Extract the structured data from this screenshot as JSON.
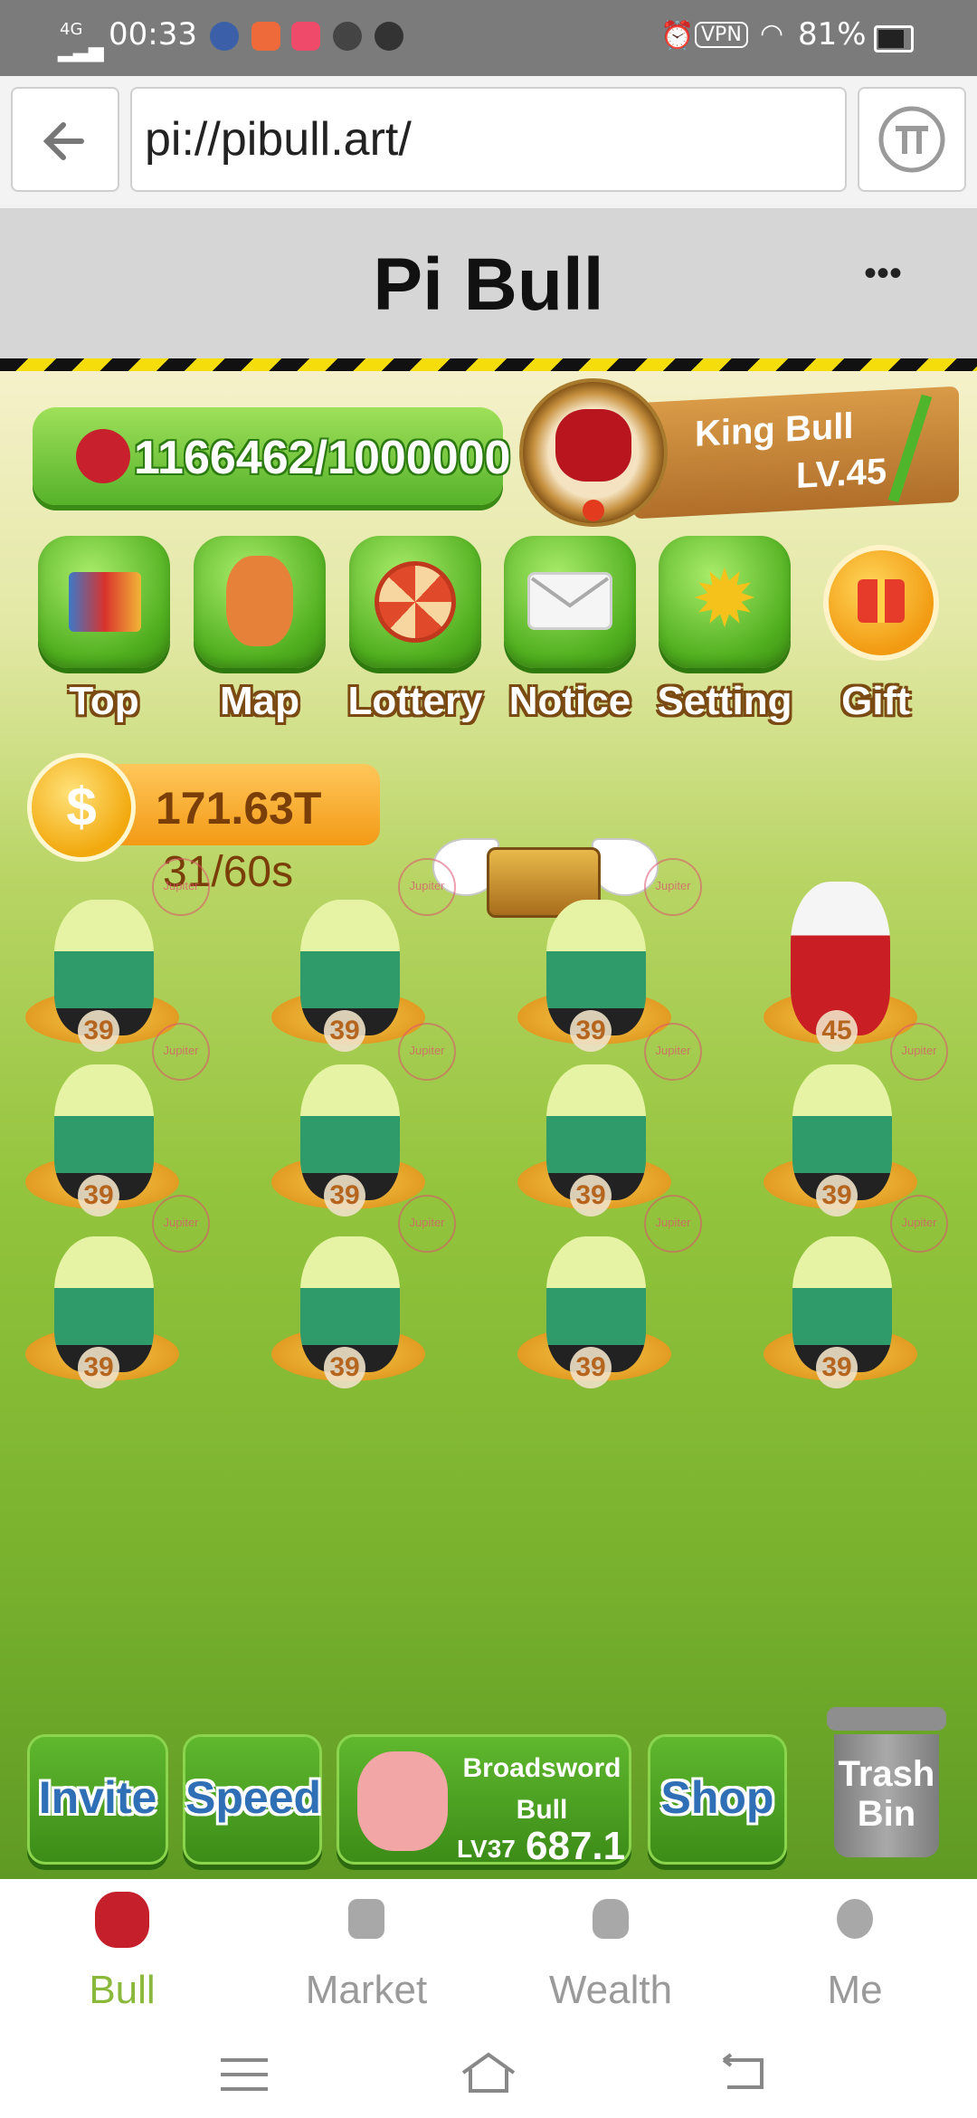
{
  "status_bar": {
    "time": "00:33",
    "network": "4G",
    "vpn": "VPN",
    "battery": "81%"
  },
  "browser": {
    "url": "pi://pibull.art/",
    "back_icon": "arrow-left-icon",
    "pi_icon": "pi-logo-icon"
  },
  "title_bar": {
    "title": "Pi Bull",
    "menu": "•••"
  },
  "game": {
    "progress": "1166462/1000000",
    "player": {
      "name": "King Bull",
      "level": "LV.45"
    },
    "menu_buttons": [
      {
        "label": "Top",
        "icon": "ranking-icon"
      },
      {
        "label": "Map",
        "icon": "map-icon"
      },
      {
        "label": "Lottery",
        "icon": "lottery-wheel-icon"
      },
      {
        "label": "Notice",
        "icon": "envelope-icon"
      },
      {
        "label": "Setting",
        "icon": "gear-icon"
      },
      {
        "label": "Gift",
        "icon": "gift-icon"
      }
    ],
    "coins": "171.63T",
    "timer": "31/60s",
    "watermark": "Jupiter",
    "bull_levels": [
      "39",
      "39",
      "39",
      "45",
      "39",
      "39",
      "39",
      "39",
      "39",
      "39",
      "39",
      "39"
    ],
    "bottom_buttons": {
      "invite": "Invite",
      "speed": "Speed",
      "buy_name_line1": "Broadsword",
      "buy_name_line2": "Bull",
      "buy_level": "LV37",
      "buy_price": "687.1",
      "shop": "Shop",
      "trash_line1": "Trash",
      "trash_line2": "Bin"
    }
  },
  "tabs": [
    {
      "label": "Bull",
      "active": true,
      "icon": "bull-avatar-icon"
    },
    {
      "label": "Market",
      "active": false,
      "icon": "store-icon"
    },
    {
      "label": "Wealth",
      "active": false,
      "icon": "money-bag-icon"
    },
    {
      "label": "Me",
      "active": false,
      "icon": "profile-icon"
    }
  ],
  "colors": {
    "accent_green": "#8ab83a",
    "hazard_yellow": "#f5dd0c",
    "tab_inactive": "#9a9a9a"
  }
}
